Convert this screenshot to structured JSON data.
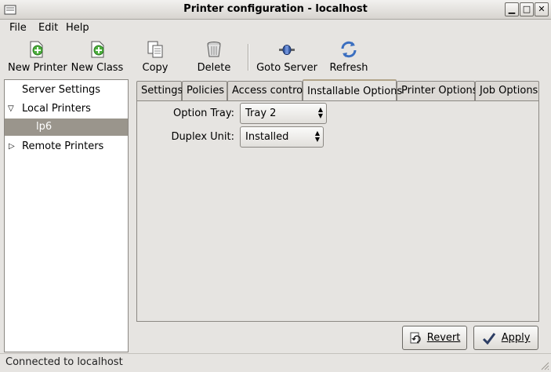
{
  "window": {
    "title": "Printer configuration - localhost",
    "minimize_glyph": "▁",
    "maximize_glyph": "□",
    "close_glyph": "✕"
  },
  "menu": [
    {
      "label": "File"
    },
    {
      "label": "Edit"
    },
    {
      "label": "Help"
    }
  ],
  "toolbar": {
    "new_printer": {
      "label": "New Printer",
      "icon": "new-printer-icon"
    },
    "new_class": {
      "label": "New Class",
      "icon": "new-class-icon"
    },
    "copy": {
      "label": "Copy",
      "icon": "copy-icon"
    },
    "delete": {
      "label": "Delete",
      "icon": "trash-icon"
    },
    "goto_server": {
      "label": "Goto Server",
      "icon": "connect-icon"
    },
    "refresh": {
      "label": "Refresh",
      "icon": "refresh-icon"
    }
  },
  "tree": {
    "server_settings": "Server Settings",
    "local_printers": "Local Printers",
    "printer": "lp6",
    "remote_printers": "Remote Printers"
  },
  "tabs": [
    {
      "label": "Settings"
    },
    {
      "label": "Policies"
    },
    {
      "label": "Access control"
    },
    {
      "label": "Installable Options",
      "active": true
    },
    {
      "label": "Printer Options"
    },
    {
      "label": "Job Options"
    }
  ],
  "options": {
    "option_tray": {
      "label": "Option Tray:",
      "value": "Tray 2"
    },
    "duplex_unit": {
      "label": "Duplex Unit:",
      "value": "Installed"
    }
  },
  "buttons": {
    "revert": "Revert",
    "apply": "Apply"
  },
  "status": "Connected to localhost",
  "colors": {
    "selection": "#9a958c",
    "window_bg": "#e6e4e1",
    "active_tab_accent": "#b2a48a"
  }
}
